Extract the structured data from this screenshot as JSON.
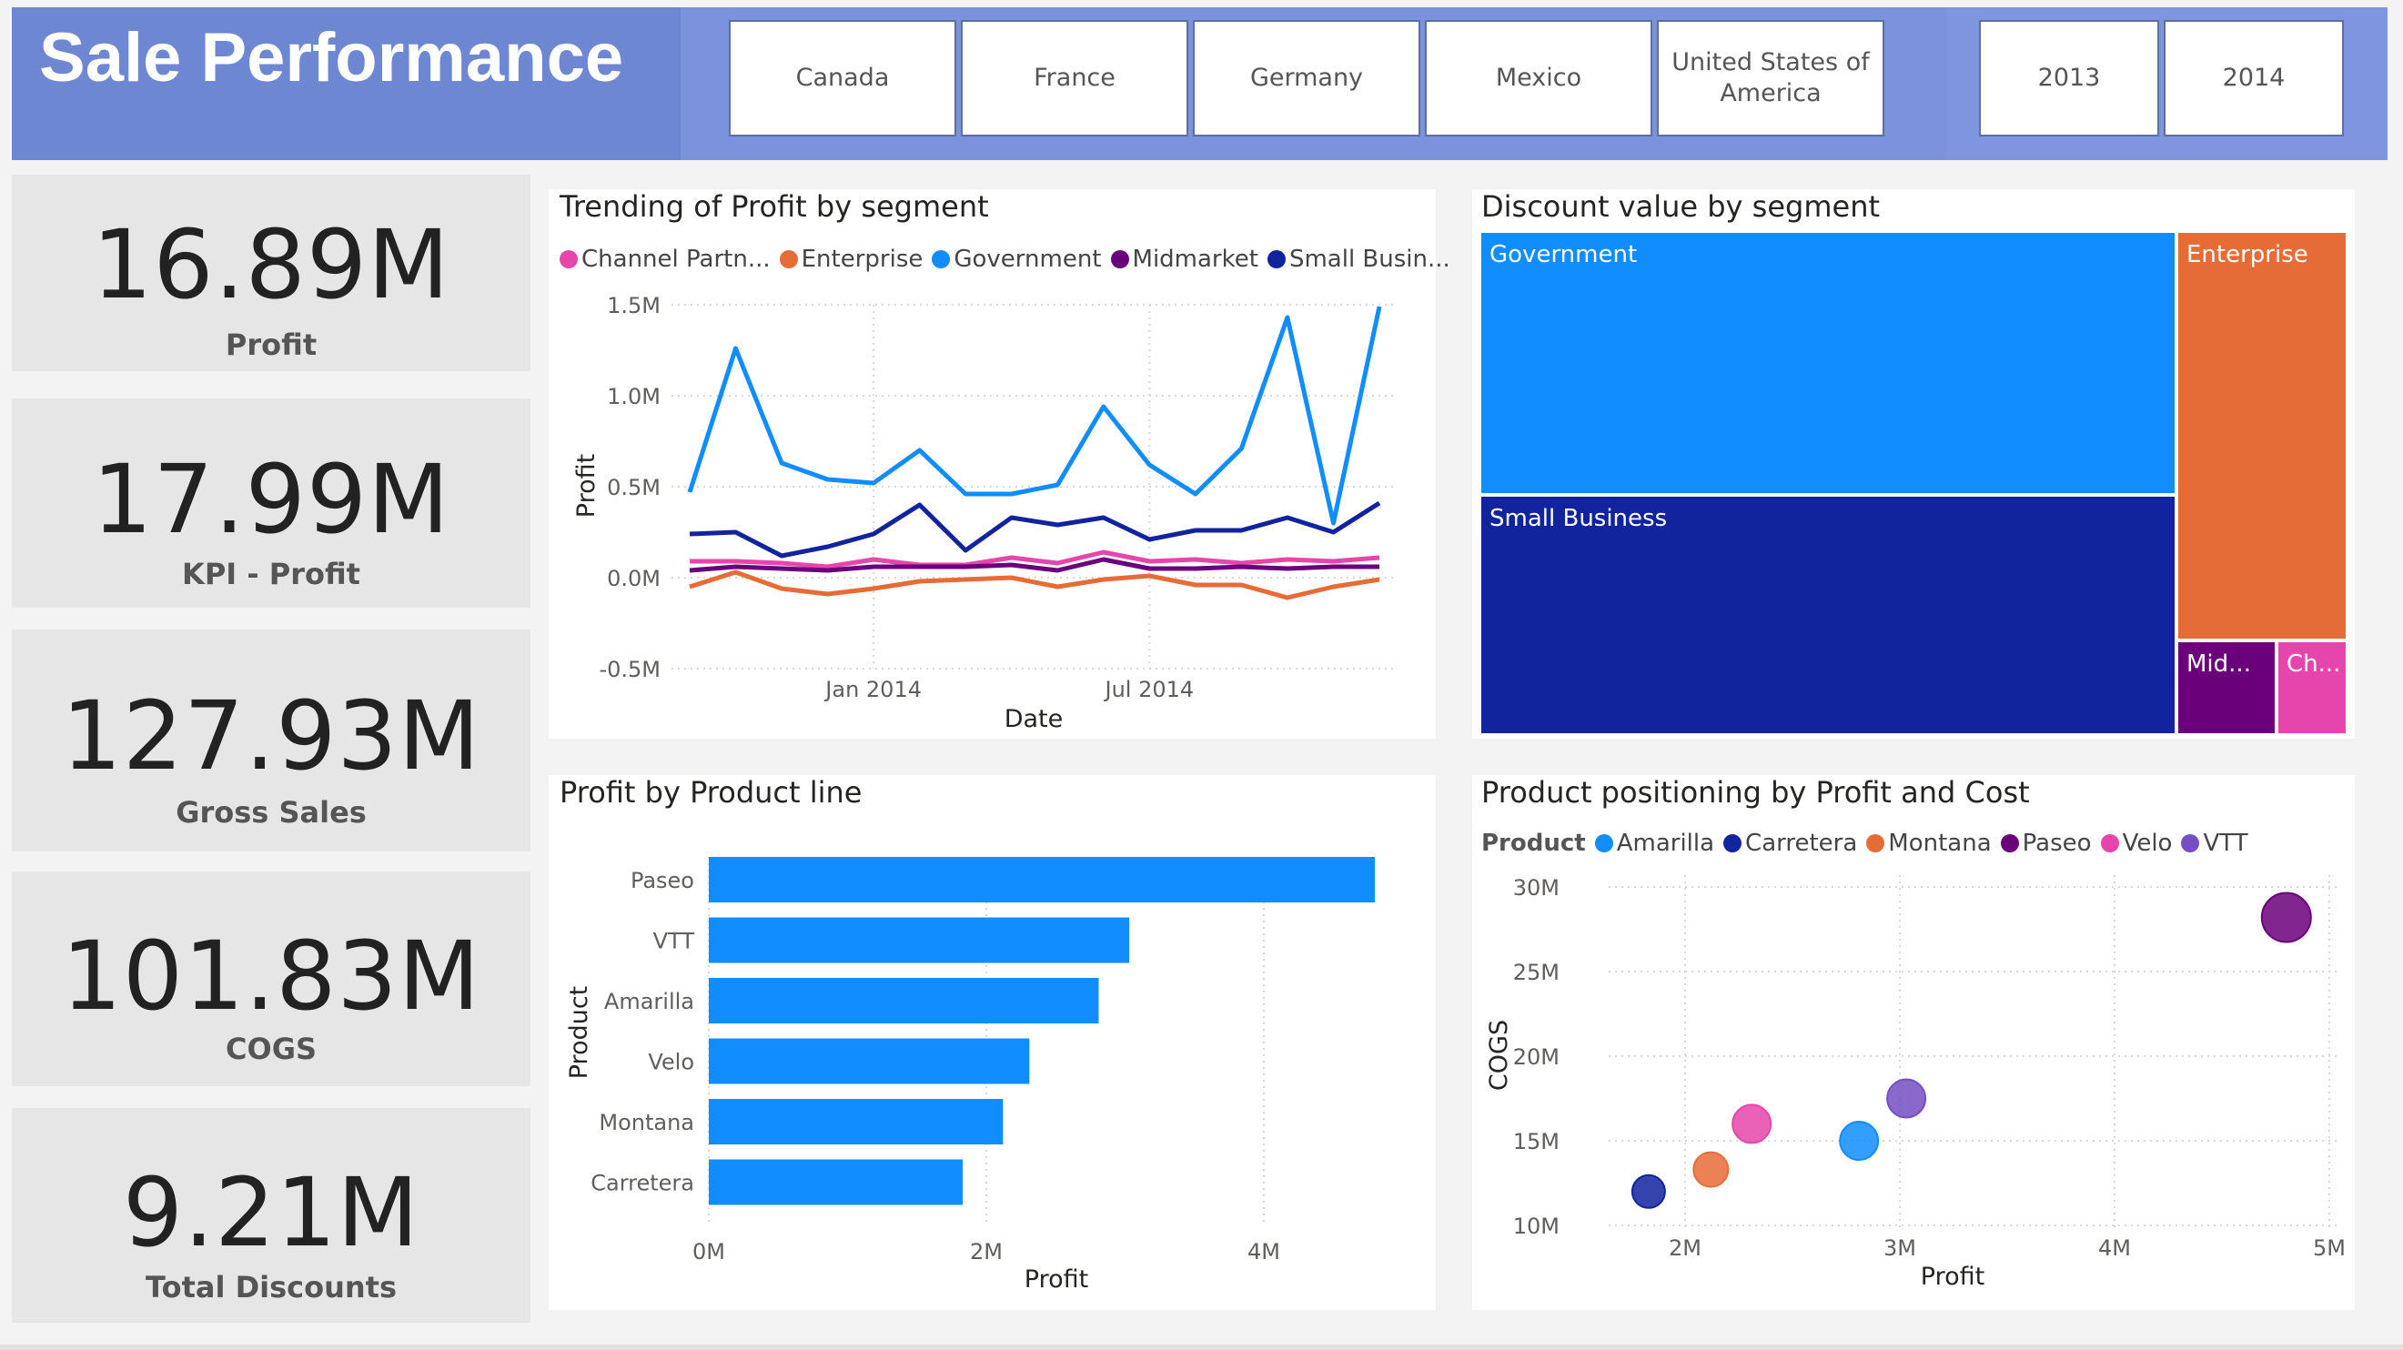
{
  "header": {
    "title": "Sale Performance",
    "countries": [
      "Canada",
      "France",
      "Germany",
      "Mexico",
      "United States of America"
    ],
    "years": [
      "2013",
      "2014"
    ]
  },
  "kpis": [
    {
      "value": "16.89M",
      "label": "Profit"
    },
    {
      "value": "17.99M",
      "label": "KPI - Profit"
    },
    {
      "value": "127.93M",
      "label": "Gross Sales"
    },
    {
      "value": "101.83M",
      "label": "COGS"
    },
    {
      "value": "9.21M",
      "label": "Total Discounts"
    }
  ],
  "colors": {
    "channel_partners": "#e645ab",
    "enterprise": "#e66c37",
    "government": "#118dff",
    "midmarket": "#6b007b",
    "small_business": "#12239e",
    "amarilla": "#118dff",
    "carretera": "#12239e",
    "montana": "#e66c37",
    "paseo": "#6b007b",
    "velo": "#e645ab",
    "vtt": "#744ec2"
  },
  "line_chart": {
    "title": "Trending of Profit by segment",
    "legend": [
      {
        "name": "Channel Partn...",
        "key": "channel_partners"
      },
      {
        "name": "Enterprise",
        "key": "enterprise"
      },
      {
        "name": "Government",
        "key": "government"
      },
      {
        "name": "Midmarket",
        "key": "midmarket"
      },
      {
        "name": "Small Busin...",
        "key": "small_business"
      }
    ],
    "x_ticks": [
      "Jan 2014",
      "Jul 2014"
    ],
    "y_ticks": [
      "1.5M",
      "1.0M",
      "0.5M",
      "0.0M",
      "-0.5M"
    ],
    "xlabel": "Date",
    "ylabel": "Profit"
  },
  "treemap": {
    "title": "Discount value by segment",
    "labels": [
      "Government",
      "Small Business",
      "Enterprise",
      "Mid...",
      "Ch..."
    ]
  },
  "bar_chart": {
    "title": "Profit by Product line",
    "x_ticks": [
      "0M",
      "2M",
      "4M"
    ],
    "xlabel": "Profit",
    "ylabel": "Product"
  },
  "scatter": {
    "title": "Product positioning by Profit and Cost",
    "legend_title": "Product",
    "legend": [
      {
        "name": "Amarilla",
        "key": "amarilla"
      },
      {
        "name": "Carretera",
        "key": "carretera"
      },
      {
        "name": "Montana",
        "key": "montana"
      },
      {
        "name": "Paseo",
        "key": "paseo"
      },
      {
        "name": "Velo",
        "key": "velo"
      },
      {
        "name": "VTT",
        "key": "vtt"
      }
    ],
    "x_ticks": [
      "2M",
      "3M",
      "4M",
      "5M"
    ],
    "y_ticks": [
      "30M",
      "25M",
      "20M",
      "15M",
      "10M"
    ],
    "xlabel": "Profit",
    "ylabel": "COGS"
  },
  "chart_data": [
    {
      "type": "line",
      "title": "Trending of Profit by segment",
      "xlabel": "Date",
      "ylabel": "Profit",
      "ylim": [
        -0.5,
        1.5
      ],
      "x": [
        "2013-09",
        "2013-10",
        "2013-11",
        "2013-12",
        "2014-01",
        "2014-02",
        "2014-03",
        "2014-04",
        "2014-05",
        "2014-06",
        "2014-07",
        "2014-08",
        "2014-09",
        "2014-10",
        "2014-11",
        "2014-12"
      ],
      "series": [
        {
          "name": "Channel Partners",
          "key": "channel_partners",
          "values": [
            0.09,
            0.09,
            0.08,
            0.06,
            0.1,
            0.07,
            0.07,
            0.11,
            0.08,
            0.14,
            0.09,
            0.1,
            0.08,
            0.1,
            0.09,
            0.11
          ]
        },
        {
          "name": "Enterprise",
          "key": "enterprise",
          "values": [
            -0.05,
            0.03,
            -0.06,
            -0.09,
            -0.06,
            -0.02,
            -0.01,
            0.0,
            -0.05,
            -0.01,
            0.01,
            -0.04,
            -0.04,
            -0.11,
            -0.05,
            -0.01
          ]
        },
        {
          "name": "Government",
          "key": "government",
          "values": [
            0.47,
            1.26,
            0.63,
            0.54,
            0.52,
            0.7,
            0.46,
            0.46,
            0.51,
            0.94,
            0.62,
            0.46,
            0.71,
            1.43,
            0.3,
            1.49
          ]
        },
        {
          "name": "Midmarket",
          "key": "midmarket",
          "values": [
            0.04,
            0.06,
            0.05,
            0.04,
            0.06,
            0.06,
            0.06,
            0.07,
            0.04,
            0.1,
            0.05,
            0.05,
            0.06,
            0.05,
            0.06,
            0.06
          ]
        },
        {
          "name": "Small Business",
          "key": "small_business",
          "values": [
            0.24,
            0.25,
            0.12,
            0.17,
            0.24,
            0.4,
            0.15,
            0.33,
            0.29,
            0.33,
            0.21,
            0.26,
            0.26,
            0.33,
            0.25,
            0.41
          ]
        }
      ]
    },
    {
      "type": "treemap",
      "title": "Discount value by segment",
      "categories": [
        "Government",
        "Small Business",
        "Enterprise",
        "Midmarket",
        "Channel Partners"
      ],
      "values": [
        4.1,
        3.1,
        1.6,
        0.22,
        0.15
      ]
    },
    {
      "type": "bar",
      "title": "Profit by Product line",
      "orientation": "horizontal",
      "categories": [
        "Paseo",
        "VTT",
        "Amarilla",
        "Velo",
        "Montana",
        "Carretera"
      ],
      "values": [
        4.8,
        3.03,
        2.81,
        2.31,
        2.12,
        1.83
      ],
      "xlim": [
        0,
        5
      ],
      "xlabel": "Profit",
      "ylabel": "Product"
    },
    {
      "type": "scatter",
      "title": "Product positioning by Profit and Cost",
      "xlabel": "Profit",
      "ylabel": "COGS",
      "xlim": [
        1.0,
        5.0
      ],
      "ylim": [
        10,
        30
      ],
      "points": [
        {
          "name": "Amarilla",
          "key": "amarilla",
          "x": 2.81,
          "y": 15.0
        },
        {
          "name": "Carretera",
          "key": "carretera",
          "x": 1.83,
          "y": 12.0
        },
        {
          "name": "Montana",
          "key": "montana",
          "x": 2.12,
          "y": 13.3
        },
        {
          "name": "Paseo",
          "key": "paseo",
          "x": 4.8,
          "y": 28.2
        },
        {
          "name": "Velo",
          "key": "velo",
          "x": 2.31,
          "y": 16.0
        },
        {
          "name": "VTT",
          "key": "vtt",
          "x": 3.03,
          "y": 17.5
        }
      ]
    }
  ]
}
